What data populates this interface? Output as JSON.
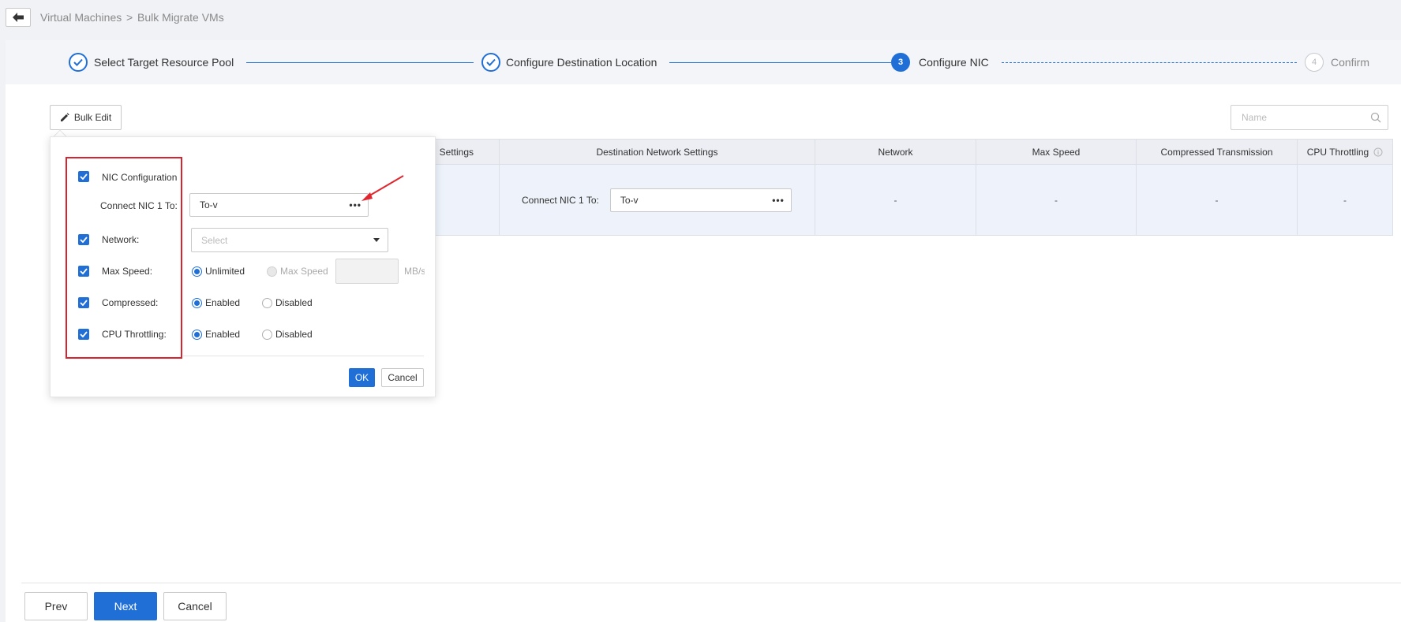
{
  "breadcrumb": {
    "root": "Virtual Machines",
    "separator": ">",
    "current": "Bulk Migrate VMs"
  },
  "steps": [
    {
      "number": "1",
      "label": "Select Target Resource Pool",
      "state": "done"
    },
    {
      "number": "2",
      "label": "Configure Destination Location",
      "state": "done"
    },
    {
      "number": "3",
      "label": "Configure NIC",
      "state": "active"
    },
    {
      "number": "4",
      "label": "Confirm",
      "state": "todo"
    }
  ],
  "toolbar": {
    "bulk_edit_label": "Bulk Edit",
    "search_placeholder": "Name"
  },
  "table": {
    "headers": {
      "source_settings_partial": "Settings",
      "destination": "Destination Network Settings",
      "network": "Network",
      "max_speed": "Max Speed",
      "compressed": "Compressed Transmission",
      "cpu": "CPU Throttling"
    },
    "row": {
      "connect_label": "Connect NIC 1 To:",
      "connect_value": "To-v",
      "network": "-",
      "max_speed": "-",
      "compressed": "-",
      "cpu": "-"
    }
  },
  "popup": {
    "nic_config_label": "NIC Configuration",
    "connect_label": "Connect NIC 1 To:",
    "connect_value": "To-v",
    "network_label": "Network:",
    "network_placeholder": "Select",
    "max_speed_label": "Max Speed:",
    "speed_unlimited": "Unlimited",
    "speed_custom": "Max Speed",
    "speed_unit": "MB/s",
    "compressed_label": "Compressed:",
    "cpu_label": "CPU Throttling:",
    "enabled": "Enabled",
    "disabled": "Disabled",
    "ok_label": "OK",
    "cancel_label": "Cancel"
  },
  "footer": {
    "prev_label": "Prev",
    "next_label": "Next",
    "cancel_label": "Cancel"
  },
  "colors": {
    "accent": "#1f6fd7",
    "highlight": "#d9232e"
  },
  "dots": "•••"
}
